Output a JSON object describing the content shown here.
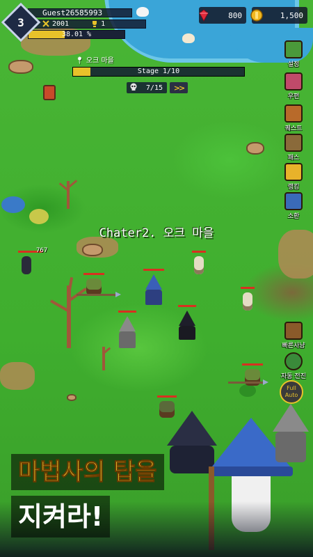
{
  "player": {
    "level": "3",
    "name": "Guest26585993",
    "power": "2001",
    "trophies": "1",
    "xp_text": "38.01 %",
    "xp_fraction": 0.38
  },
  "currency": {
    "gems": "800",
    "gold": "1,500"
  },
  "stage": {
    "location": "오크 마을",
    "label": "Stage 1/10",
    "progress_fraction": 0.1,
    "kills": "7/15"
  },
  "side_menu": [
    {
      "label": "설정",
      "icon": "gear-icon",
      "color": "#4a9a3a"
    },
    {
      "label": "우편",
      "icon": "mail-icon",
      "color": "#c04a6a"
    },
    {
      "label": "퀘스트",
      "icon": "quest-icon",
      "color": "#b86a2a"
    },
    {
      "label": "패스",
      "icon": "pass-icon",
      "color": "#8a6a3a"
    },
    {
      "label": "랭킹",
      "icon": "crown-icon",
      "color": "#e8b22a"
    },
    {
      "label": "소환",
      "icon": "summon-orb-icon",
      "color": "#3a6ab8"
    }
  ],
  "side_bottom": [
    {
      "label": "빠른사냥",
      "icon": "chest-icon"
    },
    {
      "label": "자동 전진",
      "icon": "auto-advance-icon"
    }
  ],
  "full_auto": {
    "line1": "Full",
    "line2": "Auto"
  },
  "chapter_title": "Chater2. 오크 마을",
  "damage_number": "767",
  "promo": {
    "line1": "마법사의 탑을",
    "line2": "지켜라!"
  },
  "colors": {
    "grass": "#3fae2e",
    "water": "#3aa5d8",
    "accent_gold": "#e8c22a",
    "hud_dark": "#141c32"
  }
}
